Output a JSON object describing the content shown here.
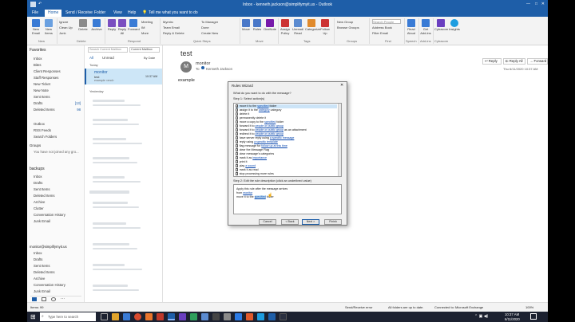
{
  "window": {
    "title": "Inbox - kenneth.jackson@simplifymyit.us - Outlook"
  },
  "tabs": [
    "File",
    "Home",
    "Send / Receive",
    "Folder",
    "View",
    "Help"
  ],
  "tell_me": "Tell me what you want to do",
  "ribbon": {
    "new_email": "New Email",
    "new_items": "New Items",
    "ignore": "Ignore",
    "clean_up": "Clean Up",
    "junk": "Junk",
    "delete": "Delete",
    "archive": "Archive",
    "reply": "Reply",
    "reply_all": "Reply All",
    "forward": "Forward",
    "meeting": "Meeting",
    "im": "IM",
    "more": "More",
    "mymtrc": "Mymtrc",
    "to_manager": "To Manager",
    "team_email": "Team Email",
    "done": "Done",
    "reply_delete": "Reply & Delete",
    "create_new": "Create New",
    "move": "Move",
    "rules": "Rules",
    "onenote": "OneNote",
    "assign_policy": "Assign Policy",
    "unread_read": "Unread/ Read",
    "categorize": "Categorize",
    "follow_up": "Follow Up",
    "new_group": "New Group",
    "browse_groups": "Browse Groups",
    "search_people": "Search People",
    "address_book": "Address Book",
    "filter_email": "Filter Email",
    "read_aloud": "Read Aloud",
    "get_addins": "Get Add-ins",
    "cytracom": "Cytracom",
    "insights": "Insights",
    "groups": {
      "new": "New",
      "delete": "Delete",
      "respond": "Respond",
      "quick_steps": "Quick Steps",
      "move": "Move",
      "tags": "Tags",
      "groups": "Groups",
      "find": "Find",
      "speech": "Speech",
      "addins": "Add-ins",
      "cytracom": "Cytracom"
    }
  },
  "folders": {
    "favorites_header": "Favorites",
    "favorites": [
      "Inbox",
      "Bites",
      "Client Responses",
      "Staff Responses",
      "New Ticket",
      "New Note",
      "Sent Items",
      "Drafts",
      "Deleted Items",
      "Outbox",
      "RSS Feeds",
      "Search Folders"
    ],
    "drafts_count": "[13]",
    "deleted_count": "98",
    "groups_header": "Groups",
    "groups_note": "You have not joined any gro...",
    "backups_header": "backups",
    "backups": [
      "Inbox",
      "Drafts",
      "Sent Items",
      "Deleted Items",
      "Archive",
      "Clutter",
      "Conversation History",
      "Junk Email"
    ],
    "account_header": "monitor@simplifymyit.us",
    "account": [
      "Inbox",
      "Drafts",
      "Sent Items",
      "Deleted Items",
      "Archive",
      "Conversation History",
      "Junk Email"
    ]
  },
  "message_list": {
    "search_placeholder": "Search Current Mailbox",
    "scope": "Current Mailbox",
    "filter_all": "All",
    "filter_unread": "Unread",
    "sort": "By Date",
    "group_today": "Today",
    "group_yesterday": "Yesterday",
    "selected": {
      "sender": "monitor",
      "subject": "test",
      "preview": "example <end>",
      "time": "10:37 AM"
    }
  },
  "reading": {
    "subject": "test",
    "avatar": "M",
    "sender": "monitor",
    "to_label": "To",
    "recipient": "Kenneth Jackson",
    "reply": "Reply",
    "reply_all": "Reply All",
    "forward": "Forward",
    "date": "Thu 6/11/2020 10:37 AM",
    "body": "example"
  },
  "dialog": {
    "title": "Rules Wizard",
    "question": "What do you want to do with the message?",
    "step1": "Step 1: Select action(s)",
    "actions": [
      {
        "pre": "move it to the ",
        "link": "specified",
        "post": " folder",
        "checked": true,
        "selected": true
      },
      {
        "pre": "assign it to the ",
        "link": "category",
        "post": " category",
        "checked": false,
        "selected": false
      },
      {
        "pre": "delete it",
        "link": "",
        "post": "",
        "checked": false,
        "selected": false
      },
      {
        "pre": "permanently delete it",
        "link": "",
        "post": "",
        "checked": false,
        "selected": false
      },
      {
        "pre": "move a copy to the ",
        "link": "specified",
        "post": " folder",
        "checked": false,
        "selected": false
      },
      {
        "pre": "forward it to ",
        "link": "people or public group",
        "post": "",
        "checked": false,
        "selected": false
      },
      {
        "pre": "forward it to ",
        "link": "people or public group",
        "post": " as an attachment",
        "checked": false,
        "selected": false
      },
      {
        "pre": "redirect it to ",
        "link": "people or public group",
        "post": "",
        "checked": false,
        "selected": false
      },
      {
        "pre": "have server reply using ",
        "link": "a specific message",
        "post": "",
        "checked": false,
        "selected": false
      },
      {
        "pre": "reply using ",
        "link": "a specific template",
        "post": "",
        "checked": false,
        "selected": false
      },
      {
        "pre": "flag message for ",
        "link": "follow up at this time",
        "post": "",
        "checked": false,
        "selected": false
      },
      {
        "pre": "clear the Message Flag",
        "link": "",
        "post": "",
        "checked": false,
        "selected": false
      },
      {
        "pre": "clear message's categories",
        "link": "",
        "post": "",
        "checked": false,
        "selected": false
      },
      {
        "pre": "mark it as ",
        "link": "importance",
        "post": "",
        "checked": false,
        "selected": false
      },
      {
        "pre": "print it",
        "link": "",
        "post": "",
        "checked": false,
        "selected": false
      },
      {
        "pre": "play ",
        "link": "a sound",
        "post": "",
        "checked": false,
        "selected": false
      },
      {
        "pre": "mark it as read",
        "link": "",
        "post": "",
        "checked": false,
        "selected": false
      },
      {
        "pre": "stop processing more rules",
        "link": "",
        "post": "",
        "checked": false,
        "selected": false
      }
    ],
    "step2": "Step 2: Edit the rule description (click an underlined value)",
    "desc_line1": "Apply this rule after the message arrives",
    "desc_line2_pre": "from ",
    "desc_line2_link": "monitor",
    "desc_line3_pre": "move it to the ",
    "desc_line3_link": "specified",
    "desc_line3_post": " folder",
    "cancel": "Cancel",
    "back": "< Back",
    "next": "Next >",
    "finish": "Finish"
  },
  "status": {
    "items": "Items: 99",
    "send_receive": "Send/Receive error",
    "up_to_date": "All folders are up to date.",
    "connected": "Connected to: Microsoft Exchange",
    "zoom": "100%"
  },
  "taskbar": {
    "search": "Type here to search",
    "time": "10:37 AM",
    "date": "6/11/2020"
  },
  "colors": {
    "accent": "#1e5ea8",
    "selection": "#cce4f7"
  }
}
